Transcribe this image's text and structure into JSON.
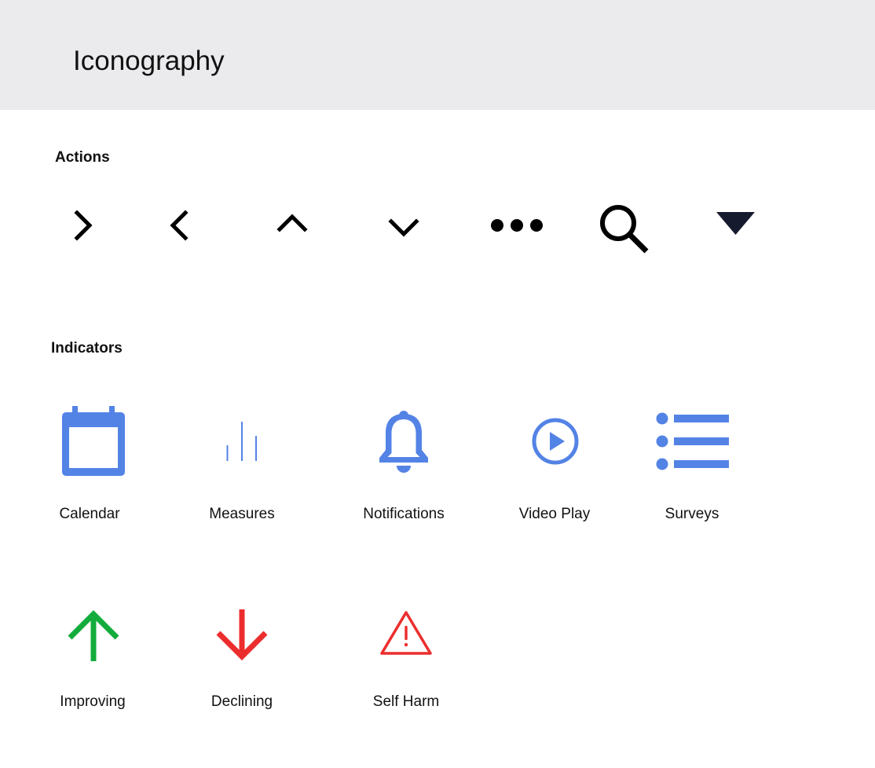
{
  "page": {
    "title": "Iconography"
  },
  "sections": {
    "actions": {
      "title": "Actions",
      "icons": [
        "chevron-right-icon",
        "chevron-left-icon",
        "chevron-up-icon",
        "chevron-down-icon",
        "more-horizontal-icon",
        "search-icon",
        "caret-down-icon"
      ]
    },
    "indicators": {
      "title": "Indicators",
      "items": [
        {
          "icon": "calendar-icon",
          "label": "Calendar"
        },
        {
          "icon": "measures-icon",
          "label": "Measures"
        },
        {
          "icon": "bell-icon",
          "label": "Notifications"
        },
        {
          "icon": "video-play-icon",
          "label": "Video Play"
        },
        {
          "icon": "list-icon",
          "label": "Surveys"
        },
        {
          "icon": "arrow-up-icon",
          "label": "Improving"
        },
        {
          "icon": "arrow-down-icon",
          "label": "Declining"
        },
        {
          "icon": "warning-icon",
          "label": "Self Harm"
        }
      ]
    }
  },
  "colors": {
    "header_background": "#ebebed",
    "icon_blue": "#5483e6",
    "improving_green": "#13ac3c",
    "declining_red": "#ec2d2d",
    "action_black": "#000000",
    "caret_navy": "#161a2e"
  }
}
